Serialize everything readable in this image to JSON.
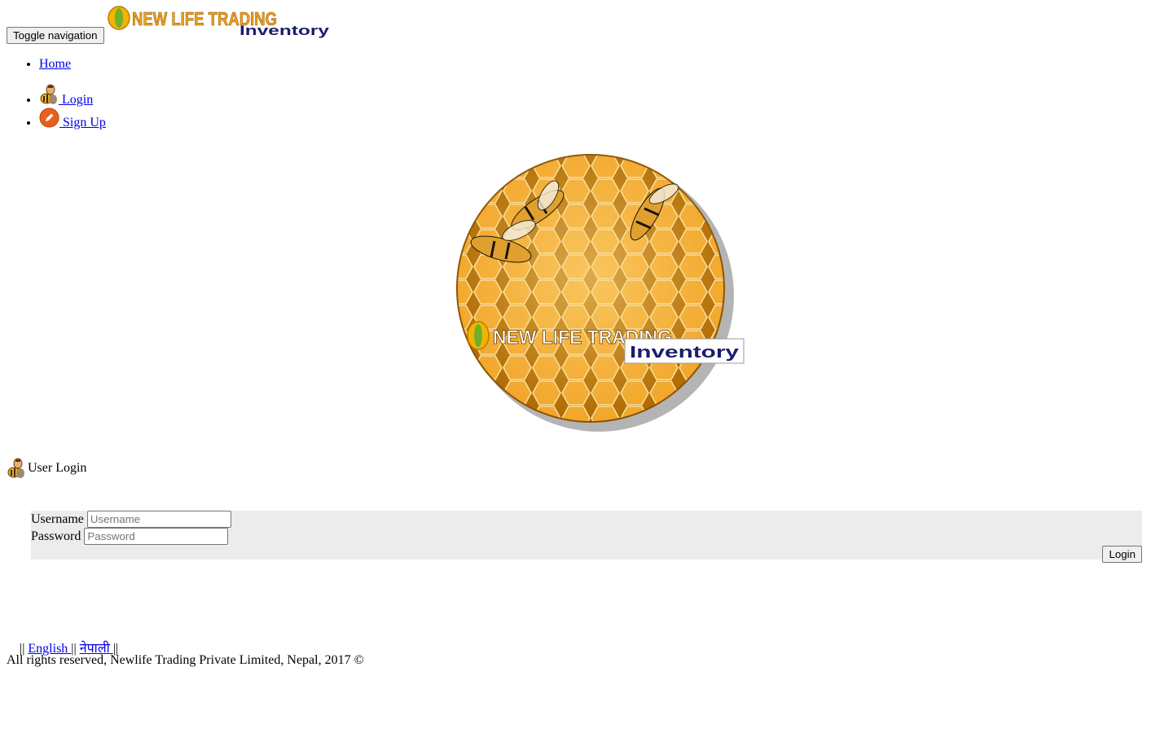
{
  "header": {
    "toggle_label": "Toggle navigation",
    "brand": {
      "line1": "NEW LIFE TRADING",
      "line2": "Inventory"
    }
  },
  "nav": {
    "items": [
      {
        "label": "Home"
      },
      {
        "label": "Login",
        "icon": "bee-user-icon"
      },
      {
        "label": "Sign Up",
        "icon": "pencil-icon"
      }
    ]
  },
  "hero": {
    "brand": {
      "line1": "NEW LIFE TRADING",
      "line2": "Inventory"
    }
  },
  "login_panel": {
    "title": "User Login",
    "title_icon": "bee-user-icon",
    "username": {
      "label": "Username",
      "placeholder": "Username",
      "value": ""
    },
    "password": {
      "label": "Password",
      "placeholder": "Password",
      "value": ""
    },
    "submit_label": "Login"
  },
  "footer": {
    "separator": "||",
    "languages": [
      {
        "label": "English"
      },
      {
        "label": "नेपाली"
      }
    ],
    "copyright": "All rights reserved, Newlife Trading Private Limited, Nepal, 2017 ©"
  },
  "colors": {
    "link": "#0000ee",
    "panel_bg": "#ececec",
    "honey": "#f0a020",
    "brand_navy": "#1c1c6e",
    "signup_icon": "#e8601c"
  }
}
